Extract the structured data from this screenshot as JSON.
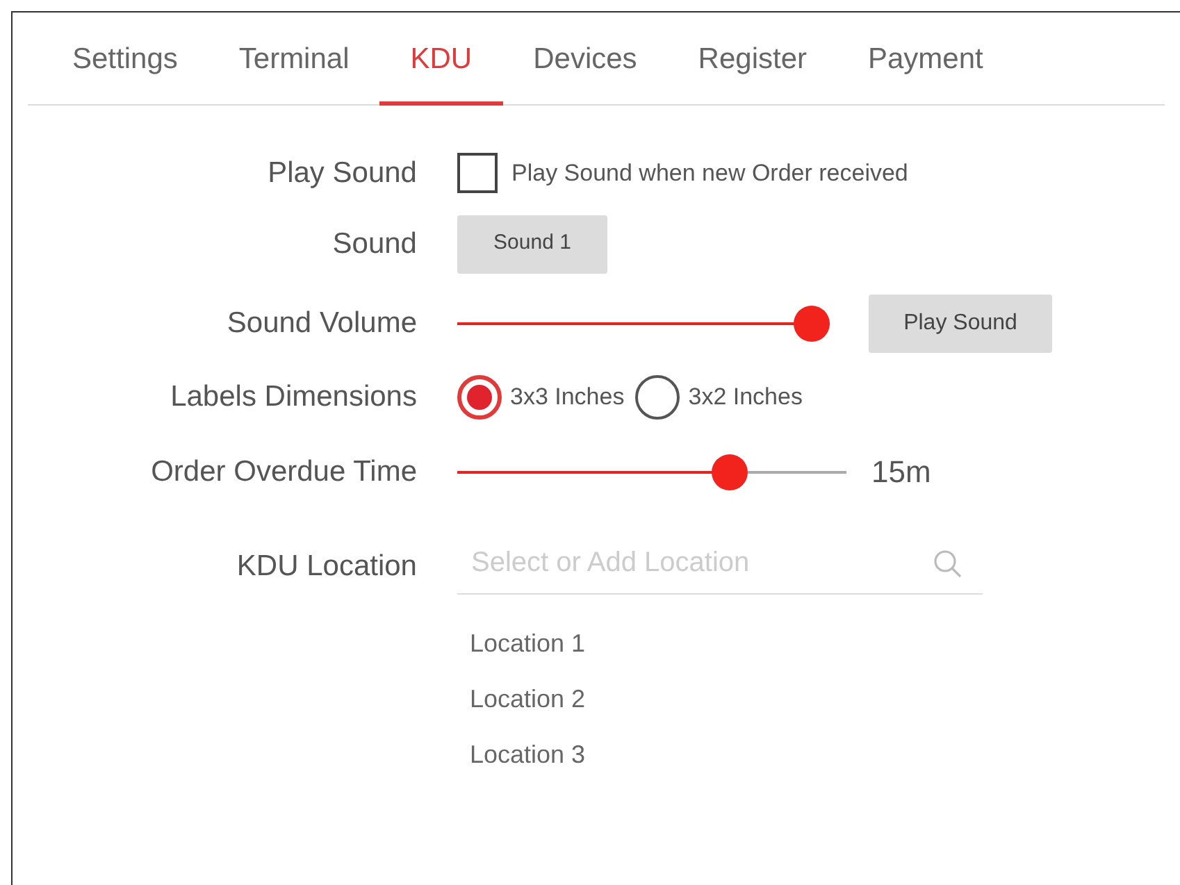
{
  "tabs": [
    {
      "label": "Settings",
      "selected": false
    },
    {
      "label": "Terminal",
      "selected": false
    },
    {
      "label": "KDU",
      "selected": true
    },
    {
      "label": "Devices",
      "selected": false
    },
    {
      "label": "Register",
      "selected": false
    },
    {
      "label": "Payment",
      "selected": false
    }
  ],
  "form": [
    {
      "kind": "checkbox",
      "label": "Play Sound",
      "text": "Play Sound when new Order received",
      "checked": false
    },
    {
      "kind": "button",
      "label": "Sound",
      "button": "Sound 1"
    },
    {
      "kind": "slider",
      "label": "Sound Volume",
      "level": 1.0,
      "button": "Play Sound"
    },
    {
      "kind": "radio",
      "label": "Labels Dimensions",
      "options": [
        {
          "label": "3x3 Inches",
          "selected": true
        },
        {
          "label": "3x2 Inches",
          "selected": false
        }
      ]
    },
    {
      "kind": "slider",
      "label": "Order Overdue Time",
      "level": 0.72,
      "reading": "15m"
    },
    {
      "kind": "location",
      "label": "KDU Location",
      "placeholder": "Select or Add Location",
      "items": [
        "Location 1",
        "Location 2",
        "Location 3"
      ]
    }
  ]
}
